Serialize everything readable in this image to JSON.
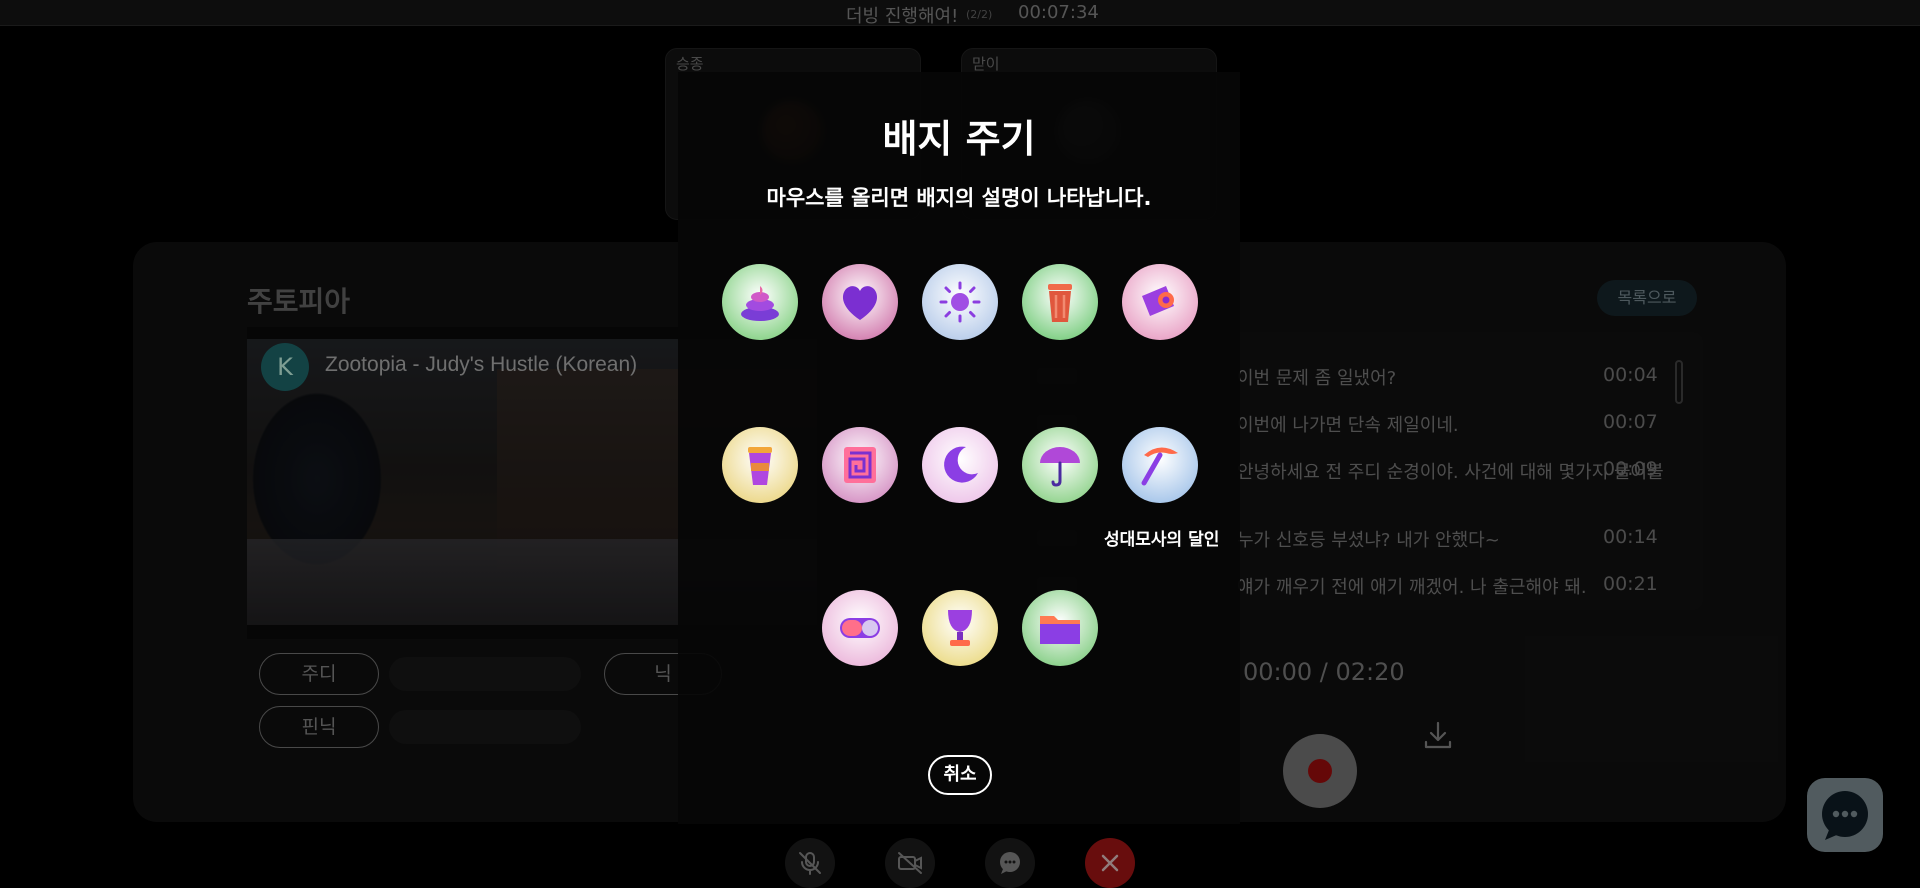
{
  "topbar": {
    "title": "더빙 진행해여!",
    "count": "(2/2)",
    "timer": "00:07:34"
  },
  "participants": [
    {
      "name": "승종"
    },
    {
      "name": "맏이"
    }
  ],
  "main": {
    "movie_title": "주토피아",
    "video": {
      "channel_initial": "K",
      "title": "Zootopia - Judy's Hustle (Korean)"
    },
    "roles": [
      "주디",
      "닉",
      "핀닉"
    ],
    "list_button": "목록으로",
    "script": [
      {
        "text": "이번 문제 좀 일냈어?",
        "time": "00:04"
      },
      {
        "text": "이번에 나가면 단속 제일이네.",
        "time": "00:07"
      },
      {
        "text": "안녕하세요 전 주디 순경이야. 사건에 대해 몇가지 물어볼",
        "time": "00:09"
      },
      {
        "text": "누가 신호등 부셨냐? 내가 안했다~",
        "time": "00:14"
      },
      {
        "text": "얘가 깨우기 전에 애기 깨겠어. 나 출근해야 돼.",
        "time": "00:21"
      }
    ],
    "time_display": "00:00 / 02:20"
  },
  "modal": {
    "title": "배지 주기",
    "subtitle": "마우스를 올리면 배지의 설명이 나타납니다.",
    "hover_tooltip": "성대모사의 달인",
    "cancel": "취소",
    "badges": [
      {
        "icon": "poop-icon",
        "bg": "#8bd38a"
      },
      {
        "icon": "heart-icon",
        "bg": "#d37fb0"
      },
      {
        "icon": "sun-icon",
        "bg": "#b9cdea"
      },
      {
        "icon": "trash-bin-icon",
        "bg": "#7fcf84"
      },
      {
        "icon": "camera-icon",
        "bg": "#e9a3c6"
      },
      {
        "icon": "cup-icon",
        "bg": "#ecd88a"
      },
      {
        "icon": "maze-icon",
        "bg": "#d694c5"
      },
      {
        "icon": "moon-icon",
        "bg": "#eec7ea"
      },
      {
        "icon": "umbrella-icon",
        "bg": "#93d48f"
      },
      {
        "icon": "pickaxe-icon",
        "bg": "#a7c6ea"
      },
      {
        "icon": "toggle-icon",
        "bg": "#ecb9dc"
      },
      {
        "icon": "trophy-icon",
        "bg": "#ecdc8a"
      },
      {
        "icon": "folder-icon",
        "bg": "#8ad08a"
      }
    ]
  }
}
